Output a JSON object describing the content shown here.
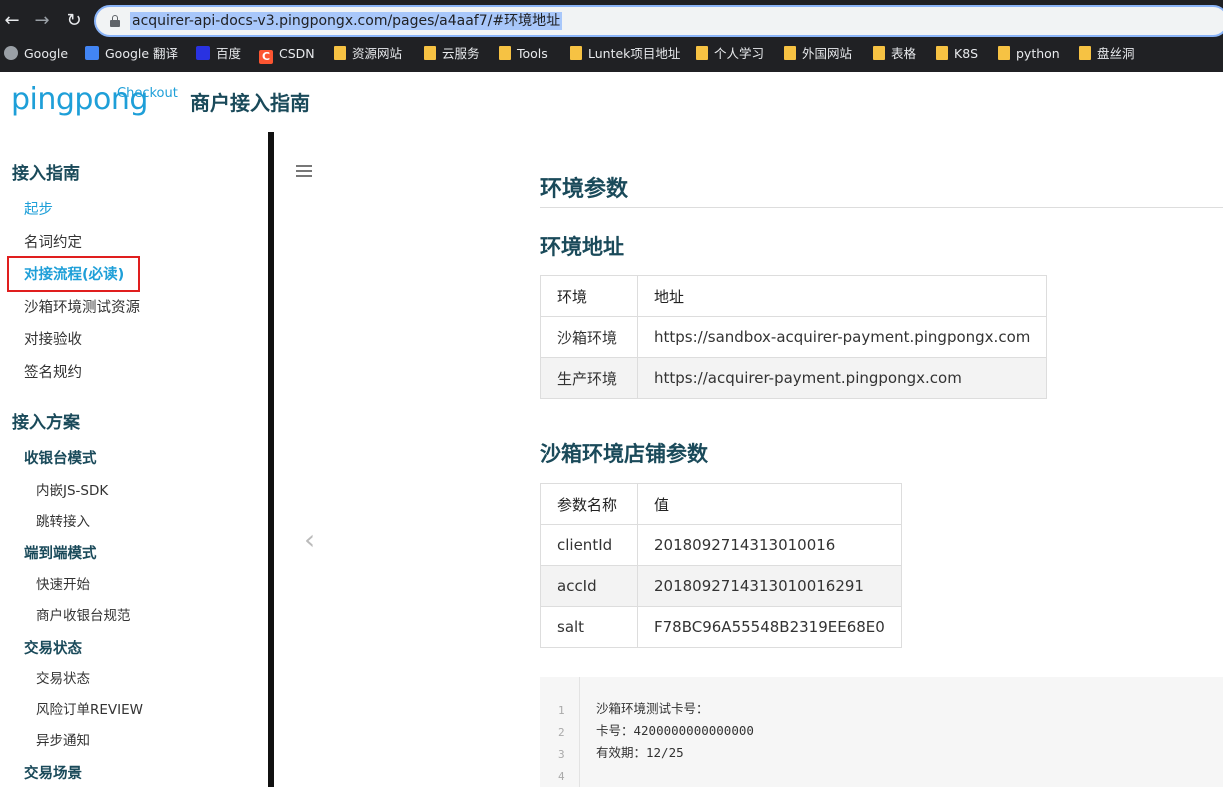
{
  "browser": {
    "url": "acquirer-api-docs-v3.pingpongx.com/pages/a4aaf7/#环境地址",
    "bookmarks": [
      "Google",
      "Google 翻译",
      "百度",
      "CSDN",
      "资源网站",
      "云服务",
      "Tools",
      "Luntek项目地址",
      "个人学习",
      "外国网站",
      "表格",
      "K8S",
      "python",
      "盘丝洞"
    ],
    "csdn_icon_letter": "C"
  },
  "header": {
    "logo": "pingpong",
    "logo_sub": "Checkout",
    "title": "商户接入指南"
  },
  "sidebar": {
    "section1": "接入指南",
    "items1": [
      "起步",
      "名词约定",
      "对接流程(必读)",
      "沙箱环境测试资源",
      "对接验收",
      "签名规约"
    ],
    "section2": "接入方案",
    "group1": "收银台模式",
    "group1_items": [
      "内嵌JS-SDK",
      "跳转接入"
    ],
    "group2": "端到端模式",
    "group2_items": [
      "快速开始",
      "商户收银台规范"
    ],
    "group3": "交易状态",
    "group3_items": [
      "交易状态",
      "风险订单REVIEW",
      "异步通知"
    ],
    "group4": "交易场景"
  },
  "main": {
    "h1": "环境参数",
    "h2_env": "环境地址",
    "env_table": {
      "headers": [
        "环境",
        "地址"
      ],
      "rows": [
        [
          "沙箱环境",
          "https://sandbox-acquirer-payment.pingpongx.com"
        ],
        [
          "生产环境",
          "https://acquirer-payment.pingpongx.com"
        ]
      ]
    },
    "h2_store": "沙箱环境店铺参数",
    "store_table": {
      "headers": [
        "参数名称",
        "值"
      ],
      "rows": [
        [
          "clientId",
          "2018092714313010016"
        ],
        [
          "accId",
          "2018092714313010016291"
        ],
        [
          "salt",
          "F78BC96A55548B2319EE68E0"
        ]
      ]
    },
    "code": {
      "line_numbers": [
        "1",
        "2",
        "3",
        "4"
      ],
      "lines": [
        "沙箱环境测试卡号：",
        "卡号：4200000000000000",
        "有效期：12/25",
        ""
      ]
    }
  }
}
